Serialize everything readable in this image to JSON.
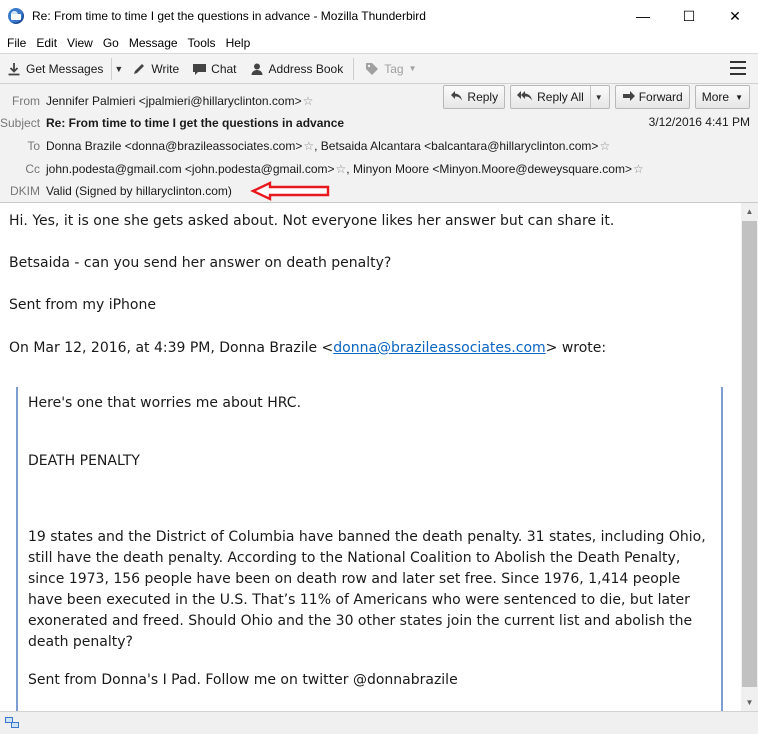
{
  "window": {
    "title": "Re: From time to time I get the questions in advance - Mozilla Thunderbird",
    "minimize": "—",
    "maximize": "☐",
    "close": "✕"
  },
  "menu": [
    "File",
    "Edit",
    "View",
    "Go",
    "Message",
    "Tools",
    "Help"
  ],
  "toolbar": {
    "get_messages": "Get Messages",
    "write": "Write",
    "chat": "Chat",
    "address_book": "Address Book",
    "tag": "Tag"
  },
  "header": {
    "from_label": "From",
    "from_value": "Jennifer Palmieri <jpalmieri@hillaryclinton.com>",
    "subject_label": "Subject",
    "subject_value": "Re: From time to time I get the questions in advance",
    "date": "3/12/2016 4:41 PM",
    "to_label": "To",
    "to_1": "Donna Brazile <donna@brazileassociates.com>",
    "to_2": "Betsaida Alcantara <balcantara@hillaryclinton.com>",
    "cc_label": "Cc",
    "cc_1": "john.podesta@gmail.com <john.podesta@gmail.com>",
    "cc_2": "Minyon Moore <Minyon.Moore@deweysquare.com>",
    "dkim_label": "DKIM",
    "dkim_value": "Valid (Signed by hillaryclinton.com)",
    "buttons": {
      "reply": "Reply",
      "reply_all": "Reply All",
      "forward": "Forward",
      "more": "More"
    }
  },
  "body": {
    "line1": "Hi.  Yes, it is one she gets asked about.  Not everyone likes her answer but can share it.",
    "line2": "Betsaida - can you send her answer on death penalty?",
    "line3": "Sent from my iPhone",
    "attribution_prefix": "On Mar 12, 2016, at 4:39 PM, Donna Brazile <",
    "attribution_link": "donna@brazileassociates.com",
    "attribution_suffix": "> wrote:",
    "quote": {
      "q1": "Here's one that worries me about HRC.",
      "q2": "DEATH PENALTY",
      "q3": "19 states and the District of Columbia have banned the death penalty. 31 states, including Ohio, still have the death penalty. According to the National Coalition to Abolish the Death Penalty, since 1973, 156 people have been on death row and later set free. Since 1976, 1,414 people have been executed in the U.S. That’s 11% of Americans who were sentenced to die, but later exonerated and freed. Should Ohio and the 30 other states join the current list and abolish the death penalty?",
      "q4": "Sent from Donna's I Pad. Follow me on twitter @donnabrazile"
    }
  },
  "colors": {
    "annotation_arrow": "#e8191e",
    "link": "#0b65c2",
    "quote_bar": "#7e9ed2"
  }
}
